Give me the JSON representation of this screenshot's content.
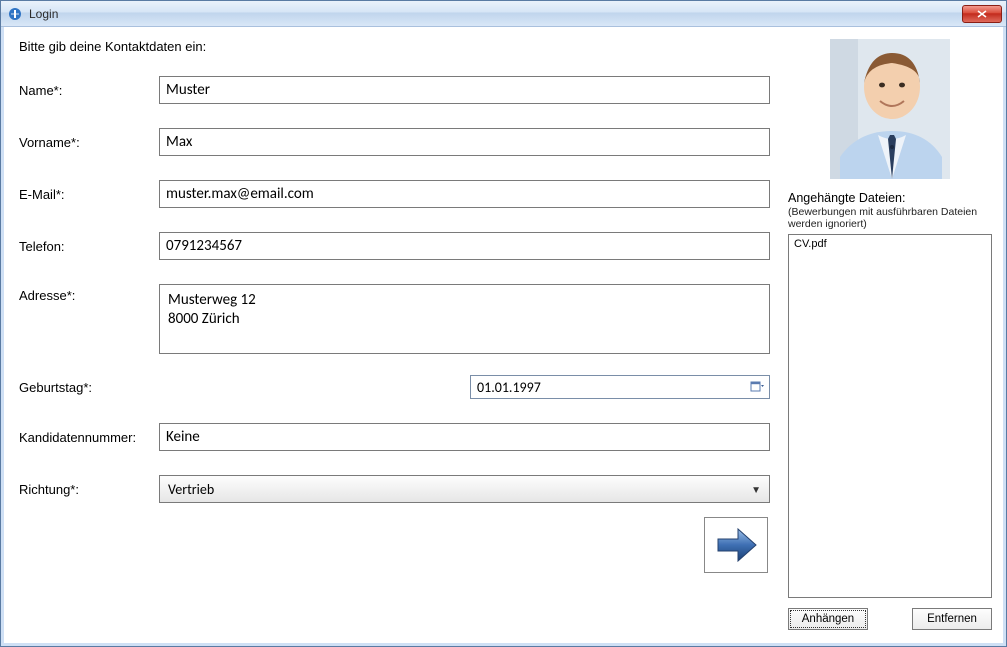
{
  "window": {
    "title": "Login"
  },
  "intro": "Bitte gib deine Kontaktdaten ein:",
  "labels": {
    "name": "Name*:",
    "vorname": "Vorname*:",
    "email": "E-Mail*:",
    "telefon": "Telefon:",
    "adresse": "Adresse*:",
    "geburtstag": "Geburtstag*:",
    "kandidatennummer": "Kandidatennummer:",
    "richtung": "Richtung*:"
  },
  "values": {
    "name": "Muster",
    "vorname": "Max",
    "email": "muster.max@email.com",
    "telefon": "0791234567",
    "adresse": "Musterweg 12\n8000 Zürich",
    "geburtstag": "01.01.1997",
    "kandidatennummer": "Keine",
    "richtung": "Vertrieb"
  },
  "attachments": {
    "title": "Angehängte Dateien:",
    "note": "(Bewerbungen mit ausführbaren Dateien werden ignoriert)",
    "files": [
      "CV.pdf"
    ],
    "attach_btn": "Anhängen",
    "remove_btn": "Entfernen"
  }
}
